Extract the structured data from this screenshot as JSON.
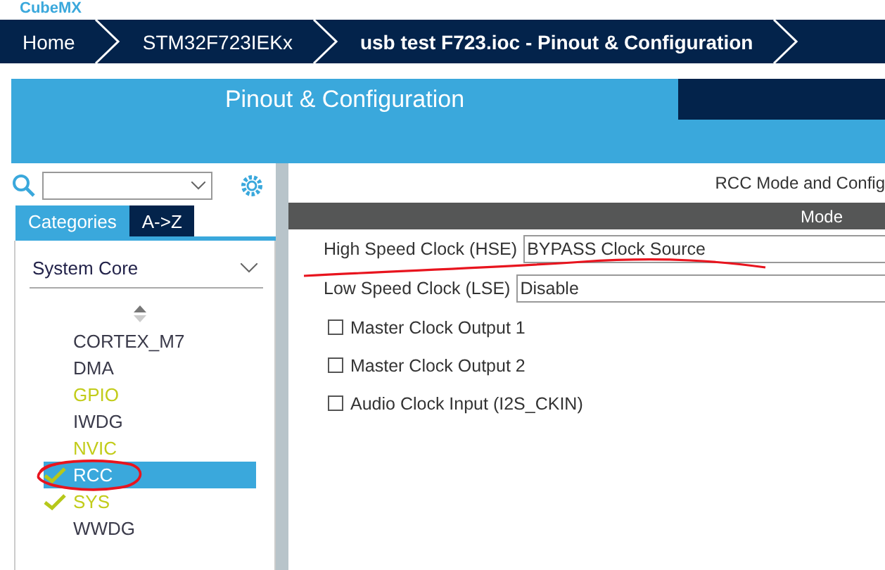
{
  "app": {
    "title": "CubeMX"
  },
  "breadcrumbs": [
    {
      "label": "Home",
      "selected": false
    },
    {
      "label": "STM32F723IEKx",
      "selected": false
    },
    {
      "label": "usb test F723.ioc - Pinout & Configuration",
      "selected": true
    }
  ],
  "main_tab": {
    "label": "Pinout & Configuration"
  },
  "sidebar": {
    "tabs": [
      {
        "label": "Categories",
        "selected": true
      },
      {
        "label": "A->Z",
        "selected": false
      }
    ],
    "category": "System Core",
    "items": [
      {
        "label": "CORTEX_M7",
        "color": "#3a3a4a",
        "checked": false,
        "selected": false
      },
      {
        "label": "DMA",
        "color": "#3a3a4a",
        "checked": false,
        "selected": false
      },
      {
        "label": "GPIO",
        "color": "#c2cc1a",
        "checked": false,
        "selected": false
      },
      {
        "label": "IWDG",
        "color": "#3a3a4a",
        "checked": false,
        "selected": false
      },
      {
        "label": "NVIC",
        "color": "#c2cc1a",
        "checked": false,
        "selected": false
      },
      {
        "label": "RCC",
        "color": "#ffffff",
        "checked": true,
        "selected": true
      },
      {
        "label": "SYS",
        "color": "#c2cc1a",
        "checked": true,
        "selected": false
      },
      {
        "label": "WWDG",
        "color": "#3a3a4a",
        "checked": false,
        "selected": false
      }
    ]
  },
  "panel": {
    "title": "RCC Mode and Config",
    "section": "Mode",
    "fields": [
      {
        "label": "High Speed Clock (HSE)",
        "value": "BYPASS Clock Source"
      },
      {
        "label": "Low Speed Clock (LSE)",
        "value": "Disable"
      }
    ],
    "options": [
      {
        "label": "Master Clock Output 1",
        "checked": false
      },
      {
        "label": "Master Clock Output 2",
        "checked": false
      },
      {
        "label": "Audio Clock Input (I2S_CKIN)",
        "checked": false
      }
    ]
  }
}
